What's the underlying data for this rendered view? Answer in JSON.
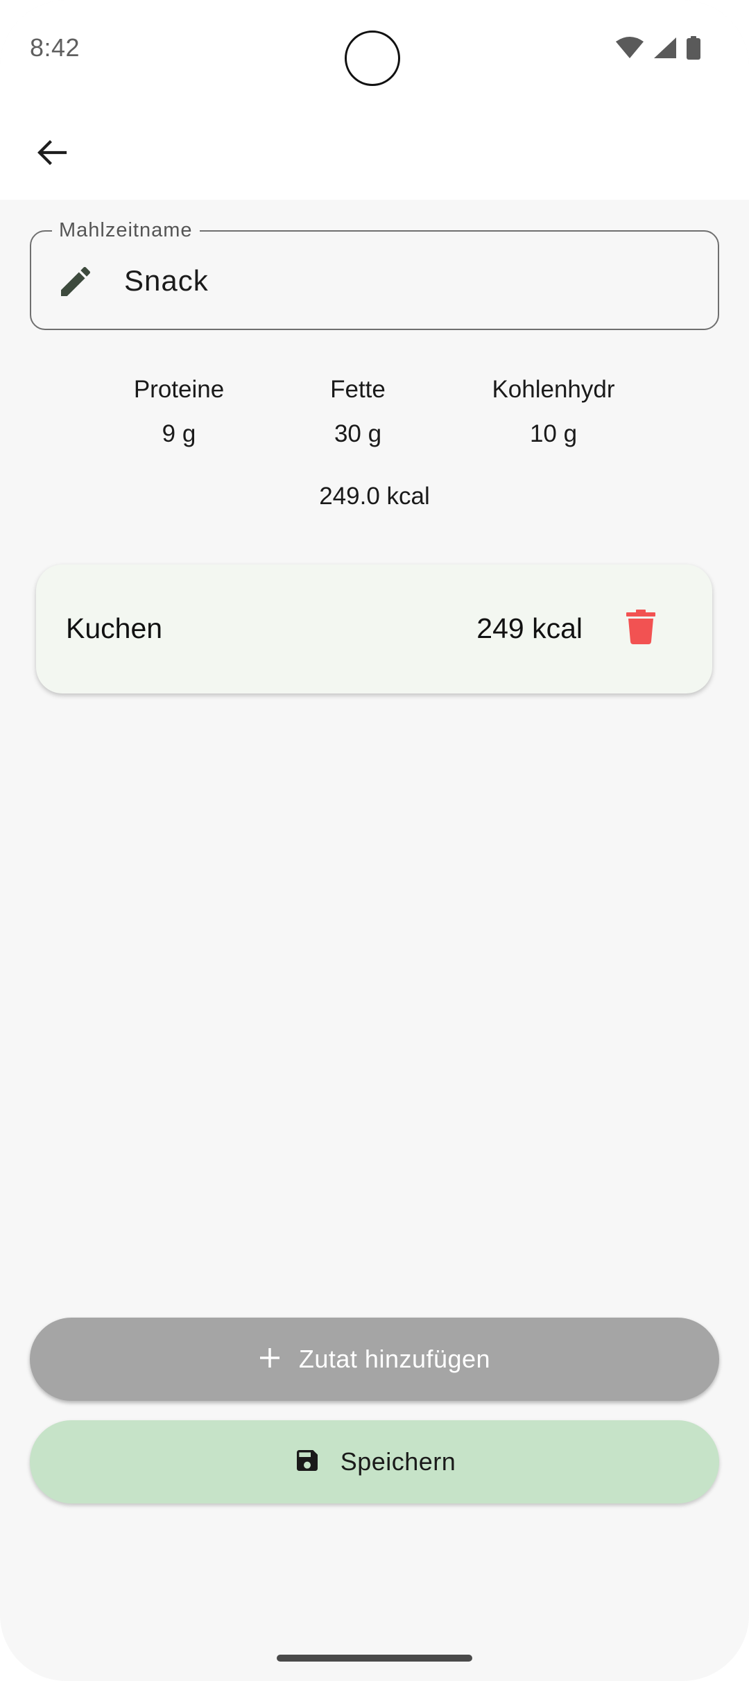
{
  "status_bar": {
    "time": "8:42",
    "icons": [
      "wifi-icon",
      "signal-icon",
      "battery-icon"
    ]
  },
  "app_bar": {
    "back_icon": "arrow-back-icon"
  },
  "meal_name_field": {
    "label": "Mahlzeitname",
    "value": "Snack",
    "icon": "pencil-icon"
  },
  "macros": [
    {
      "label": "Proteine",
      "value": "9 g"
    },
    {
      "label": "Fette",
      "value": "30 g"
    },
    {
      "label": "Kohlenhydr",
      "value": "10 g"
    }
  ],
  "total_kcal": "249.0 kcal",
  "ingredients": [
    {
      "name": "Kuchen",
      "kcal": "249 kcal",
      "delete_icon": "trash-icon"
    }
  ],
  "buttons": {
    "add_ingredient": "Zutat hinzufügen",
    "save": "Speichern"
  },
  "colors": {
    "delete": "#f25252",
    "save_button_bg": "#c6e3c8",
    "add_button_bg": "#a5a5a5",
    "card_bg": "#f3f7f1",
    "pencil_icon": "#3d4a3d"
  }
}
